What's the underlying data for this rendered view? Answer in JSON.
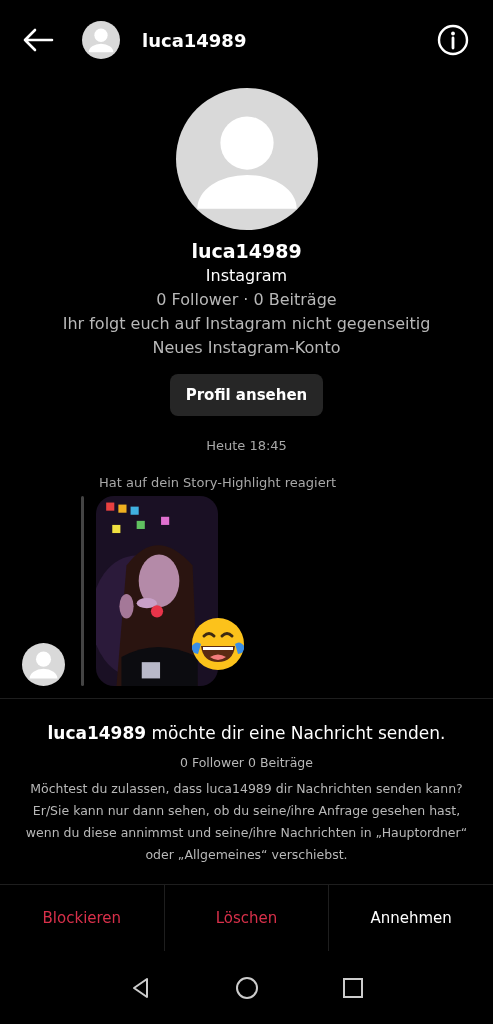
{
  "header": {
    "username": "luca14989"
  },
  "profile": {
    "name": "luca14989",
    "platform": "Instagram",
    "stats": "0 Follower · 0 Beiträge",
    "relation": "Ihr folgt euch auf Instagram nicht gegenseitig",
    "note": "Neues Instagram-Konto",
    "button": "Profil ansehen"
  },
  "timestamp": "Heute 18:45",
  "reaction": {
    "label": "Hat auf dein Story-Highlight reagiert"
  },
  "request": {
    "title": "**luca14989** möchte dir eine Nachricht senden.",
    "stats": "0 Follower 0 Beiträge",
    "text": "Möchtest du zulassen, dass luca14989 dir Nachrichten senden kann? Er/Sie kann nur dann sehen, ob du seine/ihre Anfrage gesehen hast, wenn du diese annimmst und seine/ihre Nachrichten in „Hauptordner“ oder „Allgemeines“ verschiebst."
  },
  "actions": [
    {
      "label": "Blockieren",
      "kind": "danger"
    },
    {
      "label": "Löschen",
      "kind": "danger"
    },
    {
      "label": "Annehmen",
      "kind": "default"
    }
  ]
}
